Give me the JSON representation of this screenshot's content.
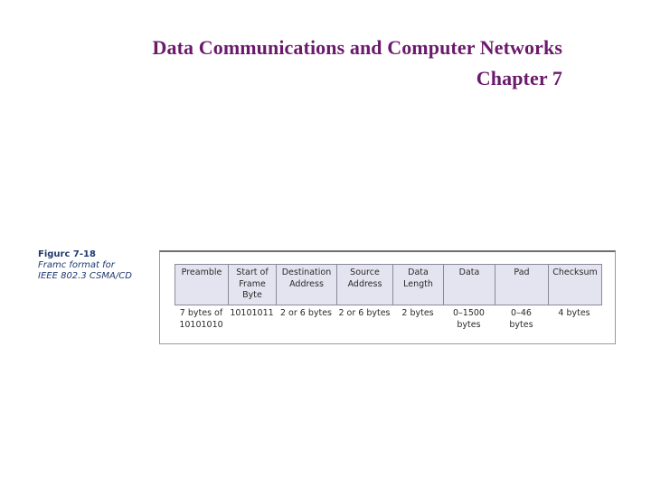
{
  "header": {
    "title": "Data Communications and Computer Networks",
    "subtitle": "Chapter 7"
  },
  "figure": {
    "number": "Figurc 7-18",
    "caption_line1": "Framc format for",
    "caption_line2": "IEEE 802.3 CSMA/CD",
    "fields": [
      {
        "name": "Preamble",
        "size": "7 bytes of\n10101010"
      },
      {
        "name": "Start of\nFrame\nByte",
        "size": "10101011"
      },
      {
        "name": "Destination\nAddress",
        "size": "2 or 6 bytes"
      },
      {
        "name": "Source\nAddress",
        "size": "2 or 6 bytes"
      },
      {
        "name": "Data\nLength",
        "size": "2 bytes"
      },
      {
        "name": "Data",
        "size": "0–1500\nbytes"
      },
      {
        "name": "Pad",
        "size": "0–46\nbytes"
      },
      {
        "name": "Checksum",
        "size": "4 bytes"
      }
    ]
  }
}
